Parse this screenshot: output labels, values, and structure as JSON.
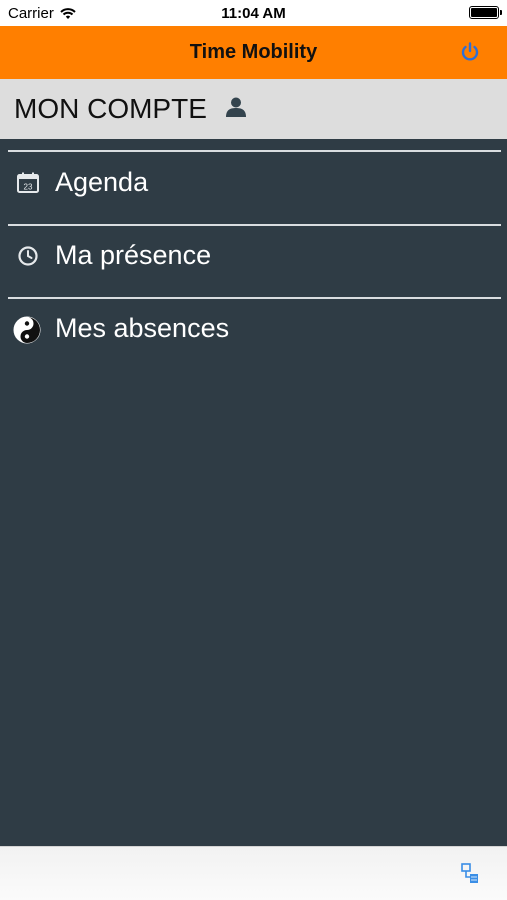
{
  "status_bar": {
    "carrier": "Carrier",
    "time": "11:04 AM"
  },
  "nav": {
    "title": "Time Mobility",
    "power_icon": "power-icon",
    "accent_color": "#ff7f00"
  },
  "account": {
    "title": "MON COMPTE",
    "icon": "user-icon"
  },
  "menu": {
    "items": [
      {
        "label": "Agenda",
        "icon": "calendar-icon"
      },
      {
        "label": "Ma présence",
        "icon": "clock-icon"
      },
      {
        "label": "Mes absences",
        "icon": "yin-yang-icon"
      }
    ]
  },
  "bottom_bar": {
    "icon": "network-icon",
    "icon_color": "#3a8ee6"
  }
}
